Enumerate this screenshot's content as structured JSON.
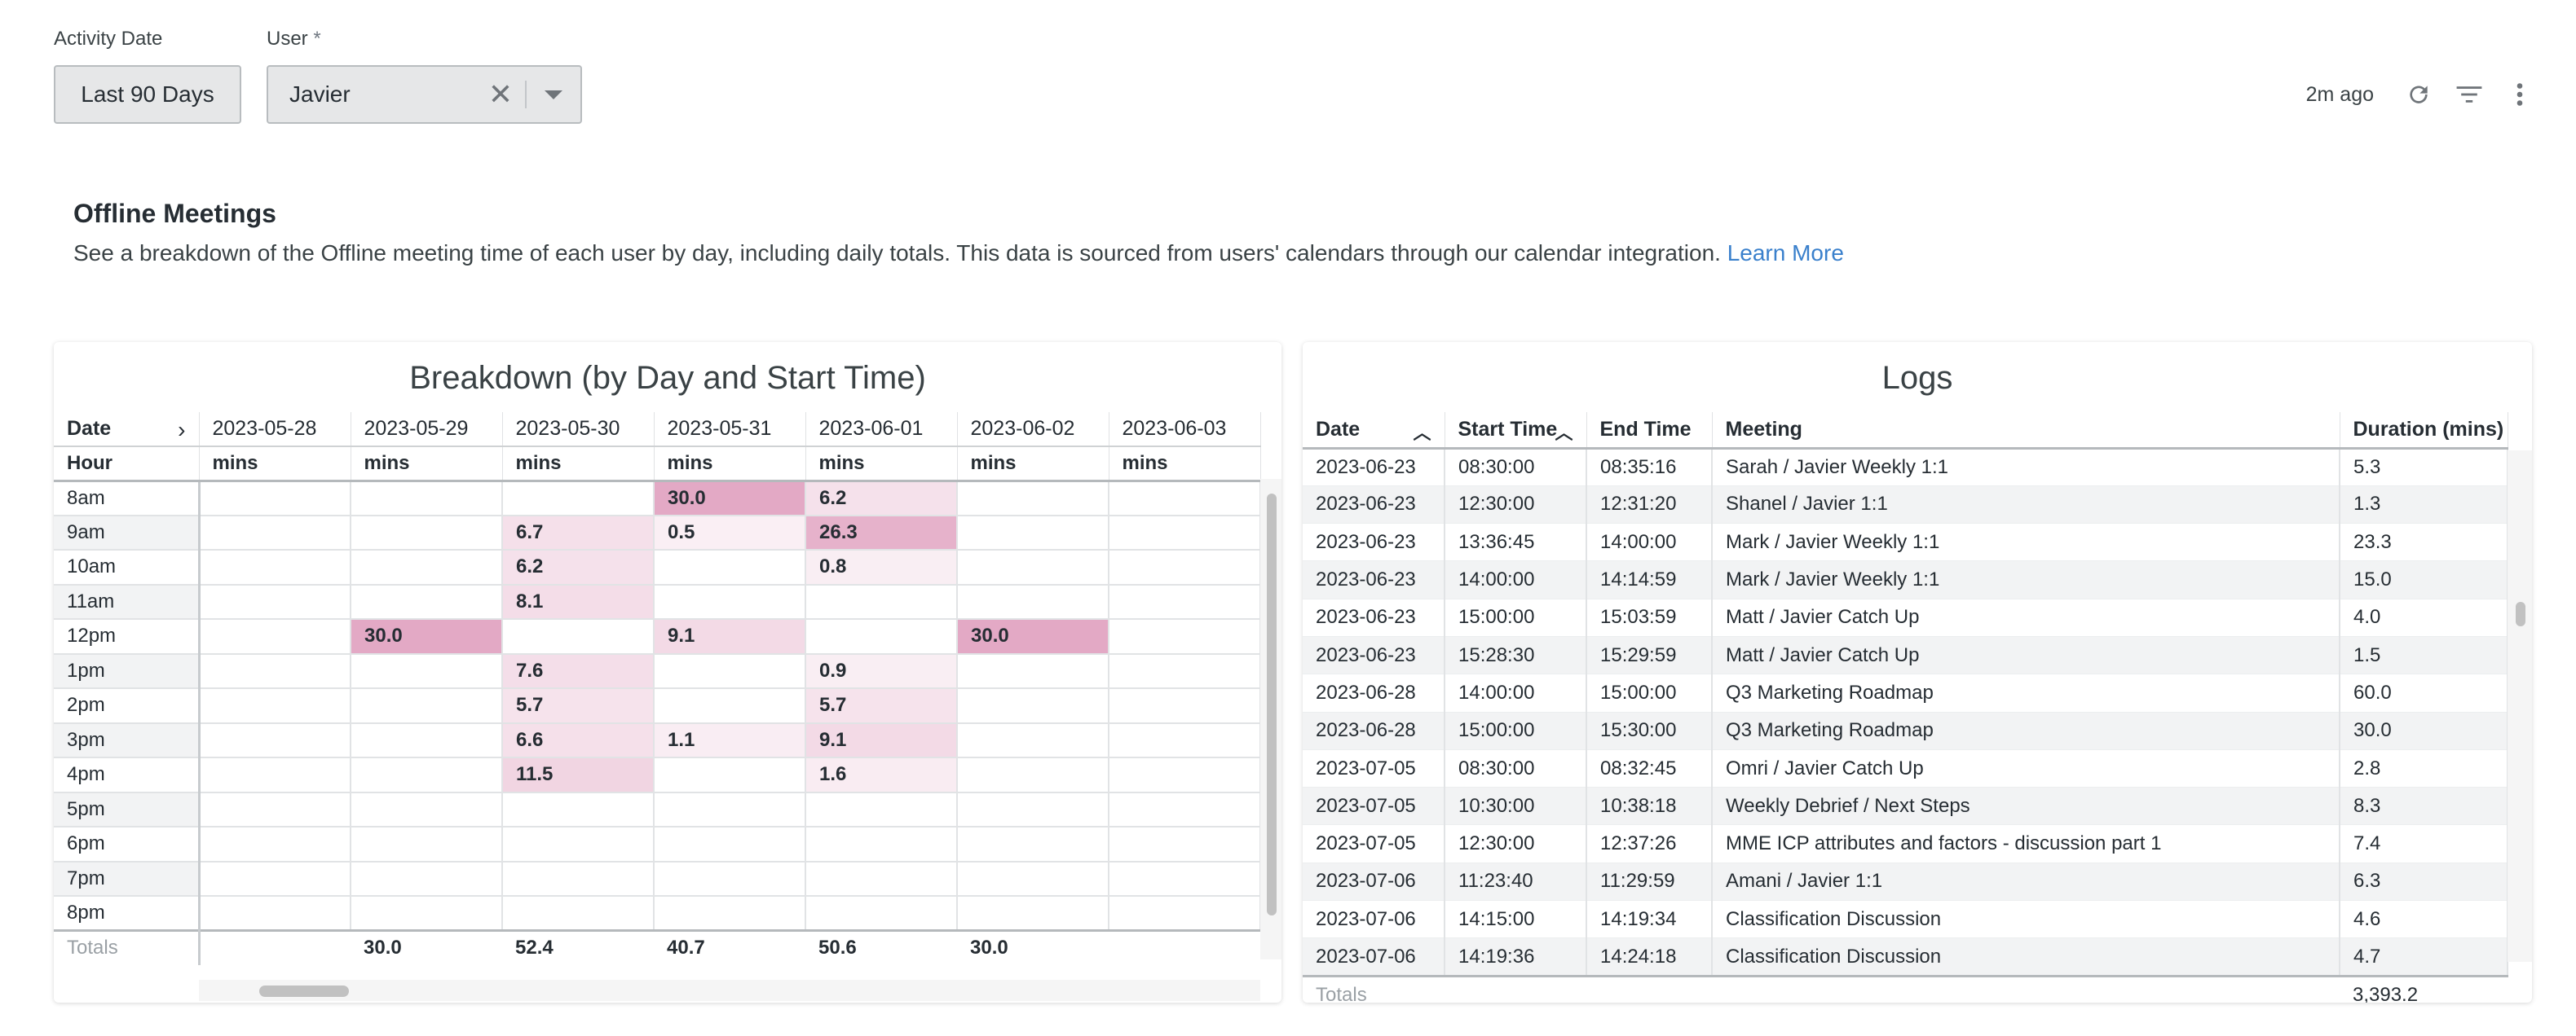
{
  "filters": {
    "date": {
      "label": "Activity Date",
      "value": "Last 90 Days"
    },
    "user": {
      "label": "User",
      "required_mark": "*",
      "value": "Javier"
    }
  },
  "toolbar": {
    "updated": "2m ago"
  },
  "header": {
    "title": "Offline Meetings",
    "description": "See a breakdown of the Offline meeting time of each user by day, including daily totals. This data is sourced from users' calendars through our calendar integration.",
    "link": "Learn More"
  },
  "breakdown": {
    "title": "Breakdown (by Day and Start Time)",
    "row_header": "Date",
    "hour_header": "Hour",
    "unit": "mins",
    "dates": [
      "2023-05-28",
      "2023-05-29",
      "2023-05-30",
      "2023-05-31",
      "2023-06-01",
      "2023-06-02",
      "2023-06-03"
    ],
    "rows": [
      {
        "hour": "8am",
        "cells": [
          "",
          "",
          "",
          "30.0",
          "6.2",
          "",
          ""
        ]
      },
      {
        "hour": "9am",
        "cells": [
          "",
          "",
          "6.7",
          "0.5",
          "26.3",
          "",
          ""
        ]
      },
      {
        "hour": "10am",
        "cells": [
          "",
          "",
          "6.2",
          "",
          "0.8",
          "",
          ""
        ]
      },
      {
        "hour": "11am",
        "cells": [
          "",
          "",
          "8.1",
          "",
          "",
          "",
          ""
        ]
      },
      {
        "hour": "12pm",
        "cells": [
          "",
          "30.0",
          "",
          "9.1",
          "",
          "30.0",
          ""
        ]
      },
      {
        "hour": "1pm",
        "cells": [
          "",
          "",
          "7.6",
          "",
          "0.9",
          "",
          ""
        ]
      },
      {
        "hour": "2pm",
        "cells": [
          "",
          "",
          "5.7",
          "",
          "5.7",
          "",
          ""
        ]
      },
      {
        "hour": "3pm",
        "cells": [
          "",
          "",
          "6.6",
          "1.1",
          "9.1",
          "",
          ""
        ]
      },
      {
        "hour": "4pm",
        "cells": [
          "",
          "",
          "11.5",
          "",
          "1.6",
          "",
          ""
        ]
      },
      {
        "hour": "5pm",
        "cells": [
          "",
          "",
          "",
          "",
          "",
          "",
          ""
        ]
      },
      {
        "hour": "6pm",
        "cells": [
          "",
          "",
          "",
          "",
          "",
          "",
          ""
        ]
      },
      {
        "hour": "7pm",
        "cells": [
          "",
          "",
          "",
          "",
          "",
          "",
          ""
        ]
      },
      {
        "hour": "8pm",
        "cells": [
          "",
          "",
          "",
          "",
          "",
          "",
          ""
        ]
      }
    ],
    "totals_label": "Totals",
    "totals": [
      "",
      "30.0",
      "52.4",
      "40.7",
      "50.6",
      "30.0",
      ""
    ],
    "heat_max": 30.0,
    "heat_color": "#c2417f"
  },
  "logs": {
    "title": "Logs",
    "columns": [
      "Date",
      "Start Time",
      "End Time",
      "Meeting",
      "Duration (mins)"
    ],
    "rows": [
      [
        "2023-06-23",
        "08:30:00",
        "08:35:16",
        "Sarah / Javier Weekly 1:1",
        "5.3"
      ],
      [
        "2023-06-23",
        "12:30:00",
        "12:31:20",
        "Shanel / Javier 1:1",
        "1.3"
      ],
      [
        "2023-06-23",
        "13:36:45",
        "14:00:00",
        "Mark / Javier Weekly 1:1",
        "23.3"
      ],
      [
        "2023-06-23",
        "14:00:00",
        "14:14:59",
        "Mark / Javier Weekly 1:1",
        "15.0"
      ],
      [
        "2023-06-23",
        "15:00:00",
        "15:03:59",
        "Matt / Javier Catch Up",
        "4.0"
      ],
      [
        "2023-06-23",
        "15:28:30",
        "15:29:59",
        "Matt / Javier Catch Up",
        "1.5"
      ],
      [
        "2023-06-28",
        "14:00:00",
        "15:00:00",
        "Q3 Marketing Roadmap",
        "60.0"
      ],
      [
        "2023-06-28",
        "15:00:00",
        "15:30:00",
        "Q3 Marketing Roadmap",
        "30.0"
      ],
      [
        "2023-07-05",
        "08:30:00",
        "08:32:45",
        "Omri / Javier Catch Up",
        "2.8"
      ],
      [
        "2023-07-05",
        "10:30:00",
        "10:38:18",
        "Weekly Debrief / Next Steps",
        "8.3"
      ],
      [
        "2023-07-05",
        "12:30:00",
        "12:37:26",
        "MME ICP attributes and factors - discussion part 1",
        "7.4"
      ],
      [
        "2023-07-06",
        "11:23:40",
        "11:29:59",
        "Amani / Javier 1:1",
        "6.3"
      ],
      [
        "2023-07-06",
        "14:15:00",
        "14:19:34",
        "Classification Discussion",
        "4.6"
      ],
      [
        "2023-07-06",
        "14:19:36",
        "14:24:18",
        "Classification Discussion",
        "4.7"
      ]
    ],
    "totals_label": "Totals",
    "total_duration": "3,393.2"
  }
}
